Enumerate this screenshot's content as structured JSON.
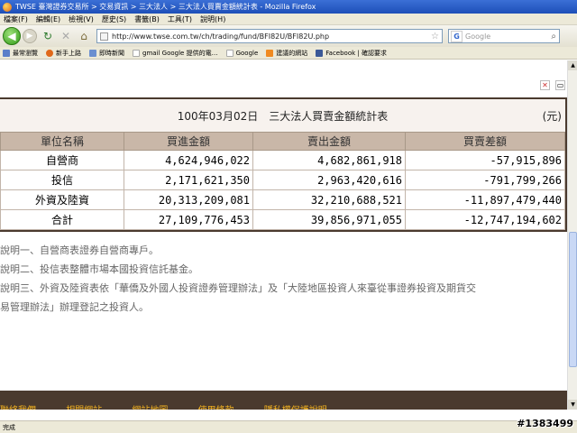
{
  "window": {
    "title": "TWSE 臺灣證券交易所 > 交易資訊 > 三大法人 > 三大法人買賣金額統計表 - Mozilla Firefox"
  },
  "menu": [
    "檔案(F)",
    "編輯(E)",
    "檢視(V)",
    "歷史(S)",
    "書籤(B)",
    "工具(T)",
    "說明(H)"
  ],
  "nav": {
    "url": "http://www.twse.com.tw/ch/trading/fund/BFI82U/BFI82U.php",
    "search_placeholder": "Google"
  },
  "bookmarks": [
    {
      "label": "最常瀏覽",
      "icon_color": "#5b7fc9"
    },
    {
      "label": "新手上路",
      "icon_color": "#e0681a"
    },
    {
      "label": "即時新聞",
      "icon_color": "#6b8fd0"
    },
    {
      "label": "gmail Google 提供的電…",
      "icon_color": "#ffffff"
    },
    {
      "label": "Google",
      "icon_color": "#ffffff"
    },
    {
      "label": "建議的網站",
      "icon_color": "#f08a20"
    },
    {
      "label": "Facebook | 確認要求",
      "icon_color": "#3b5998"
    }
  ],
  "report": {
    "title": "100年03月02日　三大法人買賣金額統計表",
    "unit": "(元)",
    "headers": [
      "單位名稱",
      "買進金額",
      "賣出金額",
      "買賣差額"
    ],
    "rows": [
      [
        "自營商",
        "4,624,946,022",
        "4,682,861,918",
        "-57,915,896"
      ],
      [
        "投信",
        "2,171,621,350",
        "2,963,420,616",
        "-791,799,266"
      ],
      [
        "外資及陸資",
        "20,313,209,081",
        "32,210,688,521",
        "-11,897,479,440"
      ],
      [
        "合計",
        "27,109,776,453",
        "39,856,971,055",
        "-12,747,194,602"
      ]
    ]
  },
  "notes": [
    "說明一、自營商表證券自營商專戶。",
    "說明二、投信表整體市場本國投資信託基金。",
    "說明三、外資及陸資表依「華僑及外國人投資證券管理辦法」及「大陸地區投資人來臺從事證券投資及期貨交",
    "易管理辦法」辦理登記之投資人。"
  ],
  "footer_links": [
    "聯絡我們",
    "相關網站",
    "網站地圖",
    "使用條款",
    "隱私權保護說明"
  ],
  "status": "完成",
  "watermark": "#1383499"
}
